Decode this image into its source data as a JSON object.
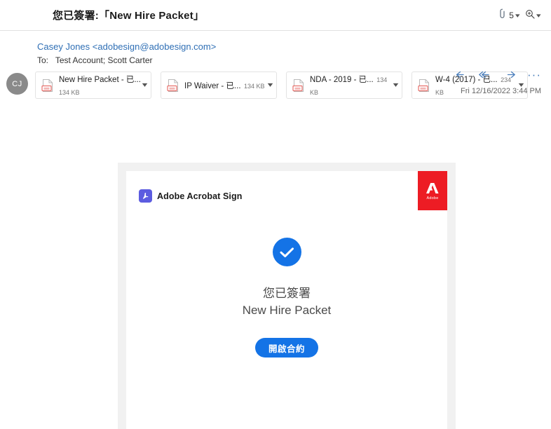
{
  "subject": {
    "text": "您已簽署:「New Hire Packet」",
    "attachment_count": "5",
    "attach_icon": "paperclip-icon",
    "zoom_icon": "magnifier-plus-icon",
    "chevron_icon": "chevron-down-icon"
  },
  "message": {
    "sender_name": "Casey Jones",
    "sender_email": "<adobesign@adobesign.com>",
    "to_label": "To:",
    "recipients": "Test Account; Scott Carter",
    "date": "Fri 12/16/2022 3:44 PM",
    "avatar_initials": "CJ",
    "actions": {
      "reply": "reply-icon",
      "reply_all": "reply-all-icon",
      "forward": "forward-icon",
      "more": "···"
    }
  },
  "attachments": [
    {
      "name": "New Hire Packet - 已...",
      "size": "134 KB",
      "type": "pdf"
    },
    {
      "name": "IP Waiver - 已...",
      "size": "134 KB",
      "type": "pdf"
    },
    {
      "name": "NDA - 2019 - 已...",
      "size": "134 KB",
      "type": "pdf"
    },
    {
      "name": "W-4 (2017) - 已...",
      "size": "234 KB",
      "type": "pdf"
    }
  ],
  "card": {
    "brand_title": "Adobe Acrobat Sign",
    "brand_icon": "acrobat-logo-icon",
    "adobe_wordmark": "Adobe",
    "status_icon": "check-circle-icon",
    "status_line1": "您已簽署",
    "status_line2": "New Hire Packet",
    "button_label": "開啟合約"
  },
  "colors": {
    "accent_blue": "#1473e6",
    "link_blue": "#2f6fb5",
    "adobe_red": "#ed1c24",
    "acrobat_purple": "#5c5ce0",
    "frame_gray": "#f1f1f1",
    "avatar_gray": "#8a8a8a"
  }
}
